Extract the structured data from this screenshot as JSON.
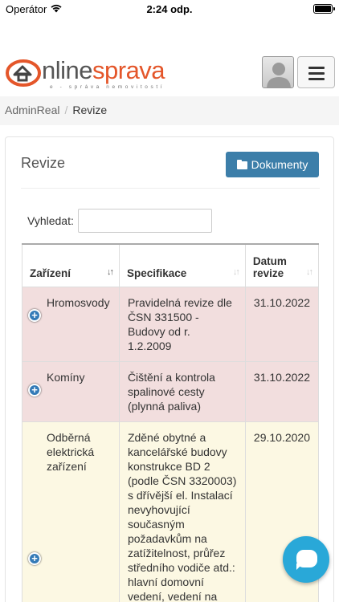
{
  "status_bar": {
    "carrier": "Operátor",
    "time": "2:24 odp."
  },
  "header": {
    "logo": {
      "part1": "nline",
      "part2": "sprava",
      "tagline": "e - správa nemovitostí"
    }
  },
  "breadcrumb": {
    "items": [
      "AdminReal",
      "Revize"
    ],
    "separator": "/"
  },
  "card": {
    "title": "Revize",
    "documents_button": "Dokumenty",
    "search_label": "Vyhledat:",
    "search_value": ""
  },
  "table": {
    "headers": [
      "Zařízení",
      "Specifikace",
      "Datum revize"
    ],
    "rows": [
      {
        "zarizeni": "Hromosvody",
        "specifikace": "Pravidelná revize dle ČSN 331500 - Budovy od r. 1.2.2009",
        "datum": "31.10.2022",
        "status": "red"
      },
      {
        "zarizeni": "Komíny",
        "specifikace": "Čištění a kontrola spalinové cesty (plynná paliva)",
        "datum": "31.10.2022",
        "status": "red"
      },
      {
        "zarizeni": "Odběrná elektrická zařízení",
        "specifikace": "Zděné obytné a kancelářské budovy konstrukce BD 2 (podle ČSN 3320003) s dřívější el. Instalací nevyhovující současným požadavkům na zatížitelnost, průřez středního vodiče atd.: hlavní domovní vedení, vedení na komunikacích a ve",
        "datum": "29.10.2020",
        "status": "yellow"
      }
    ]
  },
  "colors": {
    "accent": "#e4562a",
    "button": "#3c7ea9",
    "row_red": "#f2dede",
    "row_yellow": "#fcf8e3",
    "chat": "#29a8d8"
  }
}
